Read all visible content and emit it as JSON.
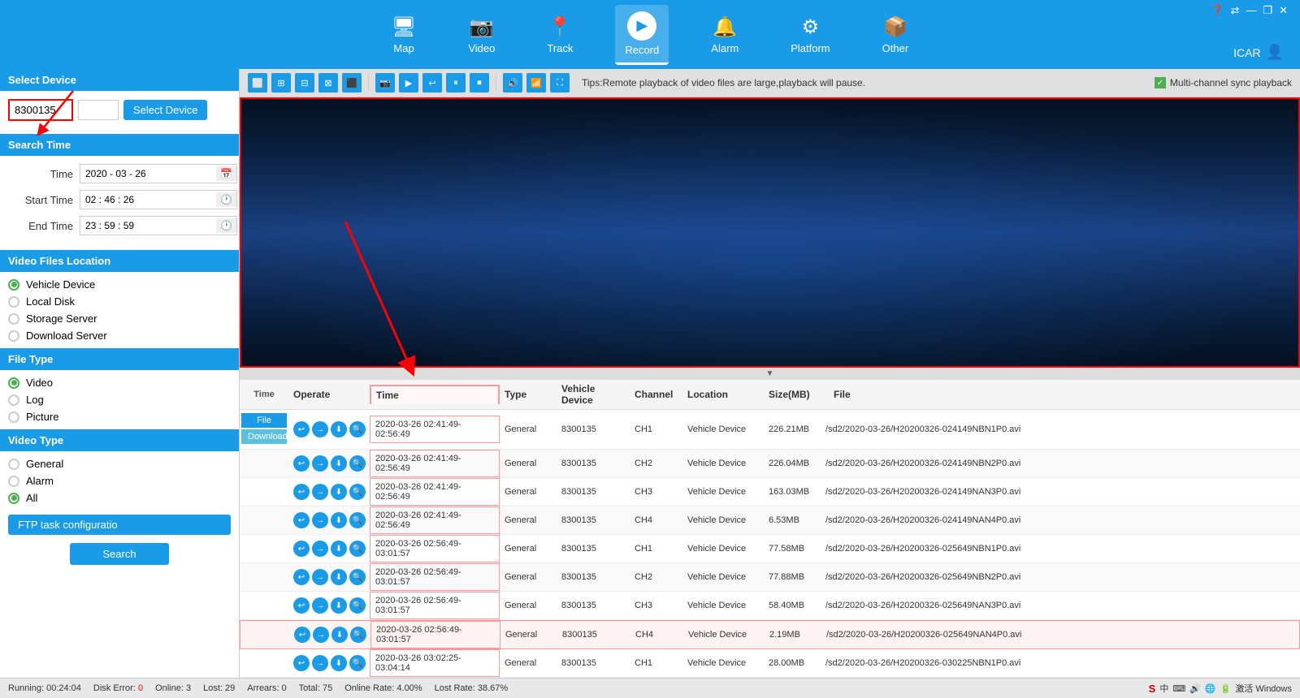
{
  "app": {
    "title": "ICAR",
    "user": "ICAR"
  },
  "nav": {
    "items": [
      {
        "id": "map",
        "label": "Map",
        "icon": "🖥",
        "active": false
      },
      {
        "id": "video",
        "label": "Video",
        "icon": "📷",
        "active": false
      },
      {
        "id": "track",
        "label": "Track",
        "icon": "📍",
        "active": false
      },
      {
        "id": "record",
        "label": "Record",
        "icon": "▶",
        "active": true
      },
      {
        "id": "alarm",
        "label": "Alarm",
        "icon": "🔔",
        "active": false
      },
      {
        "id": "platform",
        "label": "Platform",
        "icon": "⚙",
        "active": false
      },
      {
        "id": "other",
        "label": "Other",
        "icon": "📦",
        "active": false
      }
    ]
  },
  "left_panel": {
    "select_device": {
      "title": "Select Device",
      "device_id": "8300135",
      "device_extra": "",
      "btn_label": "Select Device"
    },
    "search_time": {
      "title": "Search Time",
      "time_label": "Time",
      "time_value": "2020 - 03 - 26",
      "start_time_label": "Start Time",
      "start_time_value": "02 : 46 : 26",
      "end_time_label": "End Time",
      "end_time_value": "23 : 59 : 59"
    },
    "video_files_location": {
      "title": "Video Files Location",
      "options": [
        {
          "label": "Vehicle Device",
          "active": true,
          "green": true
        },
        {
          "label": "Local Disk",
          "active": false
        },
        {
          "label": "Storage Server",
          "active": false
        },
        {
          "label": "Download Server",
          "active": false
        }
      ]
    },
    "file_type": {
      "title": "File Type",
      "options": [
        {
          "label": "Video",
          "active": true,
          "green": true
        },
        {
          "label": "Log",
          "active": false
        },
        {
          "label": "Picture",
          "active": false
        }
      ]
    },
    "video_type": {
      "title": "Video Type",
      "options": [
        {
          "label": "General",
          "active": false
        },
        {
          "label": "Alarm",
          "active": false
        },
        {
          "label": "All",
          "active": true,
          "green": true
        }
      ]
    },
    "ftp_btn": "FTP task configuratio",
    "search_btn": "Search"
  },
  "toolbar": {
    "tip": "Tips:Remote playback of video files are large,playback will pause.",
    "sync_label": "Multi-channel sync playback"
  },
  "file_table": {
    "headers": [
      "Time",
      "Operate",
      "Time",
      "Type",
      "Vehicle Device",
      "Channel",
      "Location",
      "Size(MB)",
      "File"
    ],
    "file_btn": "File",
    "download_btn": "Download",
    "rows": [
      {
        "time": "2020-03-26 02:41:49-02:56:49",
        "type": "General",
        "vehicle": "8300135",
        "channel": "CH1",
        "location": "Vehicle Device",
        "size": "226.21MB",
        "file": "/sd2/2020-03-26/H20200326-024149NBN1P0.avi"
      },
      {
        "time": "2020-03-26 02:41:49-02:56:49",
        "type": "General",
        "vehicle": "8300135",
        "channel": "CH2",
        "location": "Vehicle Device",
        "size": "226.04MB",
        "file": "/sd2/2020-03-26/H20200326-024149NBN2P0.avi"
      },
      {
        "time": "2020-03-26 02:41:49-02:56:49",
        "type": "General",
        "vehicle": "8300135",
        "channel": "CH3",
        "location": "Vehicle Device",
        "size": "163.03MB",
        "file": "/sd2/2020-03-26/H20200326-024149NAN3P0.avi"
      },
      {
        "time": "2020-03-26 02:41:49-02:56:49",
        "type": "General",
        "vehicle": "8300135",
        "channel": "CH4",
        "location": "Vehicle Device",
        "size": "6.53MB",
        "file": "/sd2/2020-03-26/H20200326-024149NAN4P0.avi"
      },
      {
        "time": "2020-03-26 02:56:49-03:01:57",
        "type": "General",
        "vehicle": "8300135",
        "channel": "CH1",
        "location": "Vehicle Device",
        "size": "77.58MB",
        "file": "/sd2/2020-03-26/H20200326-025649NBN1P0.avi"
      },
      {
        "time": "2020-03-26 02:56:49-03:01:57",
        "type": "General",
        "vehicle": "8300135",
        "channel": "CH2",
        "location": "Vehicle Device",
        "size": "77.88MB",
        "file": "/sd2/2020-03-26/H20200326-025649NBN2P0.avi"
      },
      {
        "time": "2020-03-26 02:56:49-03:01:57",
        "type": "General",
        "vehicle": "8300135",
        "channel": "CH3",
        "location": "Vehicle Device",
        "size": "58.40MB",
        "file": "/sd2/2020-03-26/H20200326-025649NAN3P0.avi"
      },
      {
        "time": "2020-03-26 02:56:49-03:01:57",
        "type": "General",
        "vehicle": "8300135",
        "channel": "CH4",
        "location": "Vehicle Device",
        "size": "2.19MB",
        "file": "/sd2/2020-03-26/H20200326-025649NAN4P0.avi",
        "highlighted": true
      },
      {
        "time": "2020-03-26 03:02:25-03:04:14",
        "type": "General",
        "vehicle": "8300135",
        "channel": "CH1",
        "location": "Vehicle Device",
        "size": "28.00MB",
        "file": "/sd2/2020-03-26/H20200326-030225NBN1P0.avi"
      }
    ]
  },
  "status_bar": {
    "running": "Running: 00:24:04",
    "disk_error_label": "Disk Error:",
    "disk_error_value": "0",
    "online_label": "Online:",
    "online_value": "3",
    "lost_label": "Lost:",
    "lost_value": "29",
    "arrears_label": "Arrears:",
    "arrears_value": "0",
    "total_label": "Total:",
    "total_value": "75",
    "online_rate_label": "Online Rate:",
    "online_rate_value": "4.00%",
    "lost_rate_label": "Lost Rate:",
    "lost_rate_value": "38.67%"
  }
}
